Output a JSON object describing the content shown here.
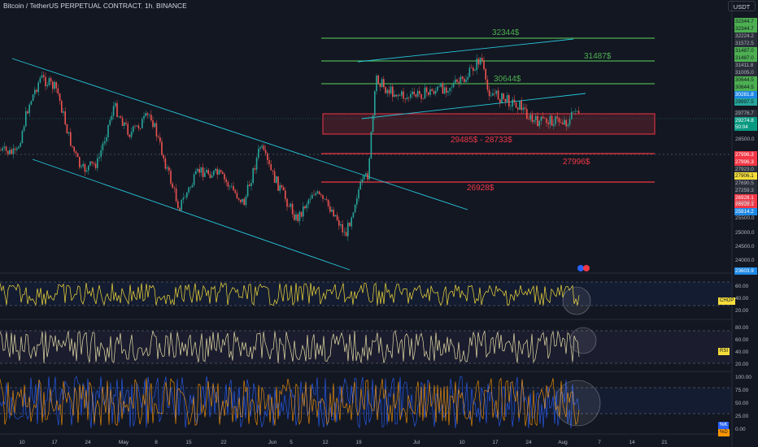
{
  "header": {
    "symbol": "Bitcoin / TetherUS PERPETUAL CONTRACT",
    "interval": "1h",
    "exchange": "BINANCE"
  },
  "currency_button": "USDT",
  "price_levels": {
    "l1": "32344$",
    "l2": "31487$",
    "l3": "30644$",
    "zone": "29485$ - 28733$",
    "l4": "27996$",
    "l5": "26928$"
  },
  "price_axis": {
    "ticks": [
      "28500.0",
      "26000.0",
      "25500.0",
      "25000.0",
      "24500.0",
      "24000.0"
    ],
    "tags": [
      {
        "text": "32344.7",
        "color": "#4caf50",
        "fg": "#131722"
      },
      {
        "text": "32344.7",
        "color": "#4caf50",
        "fg": "#131722"
      },
      {
        "text": "32224.2",
        "color": "#2a2e39",
        "fg": "#b2b5be"
      },
      {
        "text": "31572.5",
        "color": "#2a2e39",
        "fg": "#b2b5be"
      },
      {
        "text": "31487.0",
        "color": "#4caf50",
        "fg": "#131722"
      },
      {
        "text": "31487.0",
        "color": "#4caf50",
        "fg": "#131722"
      },
      {
        "text": "31411.8",
        "color": "#2a2e39",
        "fg": "#b2b5be"
      },
      {
        "text": "31005.0",
        "color": "#2a2e39",
        "fg": "#b2b5be"
      },
      {
        "text": "30644.5",
        "color": "#4caf50",
        "fg": "#131722"
      },
      {
        "text": "30644.5",
        "color": "#4caf50",
        "fg": "#131722"
      },
      {
        "text": "30281.8",
        "color": "#1e88e5",
        "fg": "#ffffff"
      },
      {
        "text": "29997.5",
        "color": "#26a69a",
        "fg": "#131722"
      },
      {
        "text": "29776.7",
        "color": "#2a2e39",
        "fg": "#b2b5be"
      },
      {
        "text": "29274.8",
        "color": "#089981",
        "fg": "#ffffff"
      },
      {
        "text": "50:04",
        "color": "#089981",
        "fg": "#ffffff"
      },
      {
        "text": "27996.3",
        "color": "#f23645",
        "fg": "#ffffff"
      },
      {
        "text": "27996.3",
        "color": "#f23645",
        "fg": "#ffffff"
      },
      {
        "text": "27923.0",
        "color": "#2a2e39",
        "fg": "#b2b5be"
      },
      {
        "text": "27906.1",
        "color": "#f5dd3a",
        "fg": "#131722"
      },
      {
        "text": "27690.5",
        "color": "#2a2e39",
        "fg": "#b2b5be"
      },
      {
        "text": "27259.3",
        "color": "#2a2e39",
        "fg": "#b2b5be"
      },
      {
        "text": "26928.1",
        "color": "#f23645",
        "fg": "#ffffff"
      },
      {
        "text": "26928.1",
        "color": "#f23645",
        "fg": "#ffffff"
      },
      {
        "text": "25814.2",
        "color": "#1e88e5",
        "fg": "#ffffff"
      },
      {
        "text": "23603.9",
        "color": "#1e88e5",
        "fg": "#ffffff"
      }
    ]
  },
  "indicators": {
    "chop": {
      "label": "CHOP",
      "ticks": [
        "60.00",
        "40.00",
        "20.00"
      ]
    },
    "rsi": {
      "label": "RSI",
      "ticks": [
        "80.00",
        "60.00",
        "40.00",
        "20.00"
      ]
    },
    "stoch": {
      "k": "%K",
      "d": "%D",
      "ticks": [
        "100.00",
        "75.00",
        "50.00",
        "25.00",
        "0.00"
      ]
    }
  },
  "time_axis": [
    "10",
    "17",
    "24",
    "May",
    "8",
    "15",
    "22",
    "Jun",
    "5",
    "12",
    "19",
    "Jul",
    "10",
    "17",
    "24",
    "Aug",
    "7",
    "14",
    "21"
  ],
  "colors": {
    "bg": "#131722",
    "green": "#4caf50",
    "red": "#f23645",
    "cyan": "#26c6da",
    "yellow": "#f5dd3a"
  }
}
